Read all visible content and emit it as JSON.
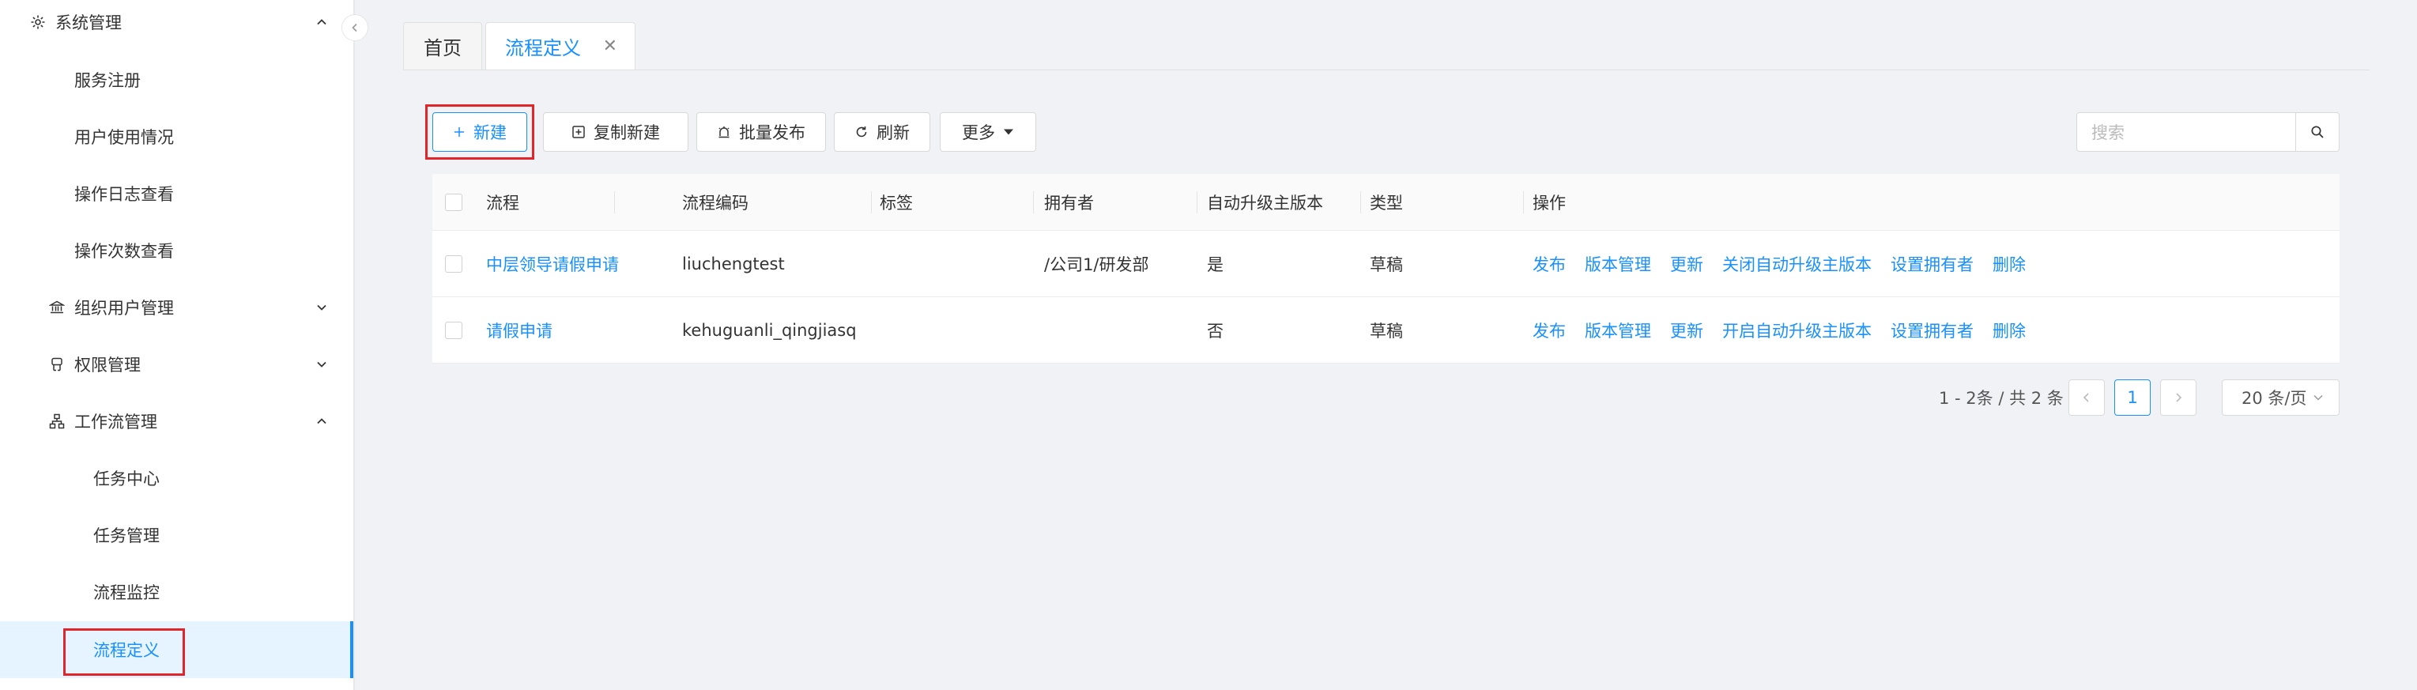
{
  "sidebar": {
    "items": [
      {
        "label": "系统管理",
        "icon": "gear-icon",
        "type": "group",
        "expanded": true
      },
      {
        "label": "服务注册",
        "type": "sub"
      },
      {
        "label": "用户使用情况",
        "type": "sub"
      },
      {
        "label": "操作日志查看",
        "type": "sub"
      },
      {
        "label": "操作次数查看",
        "type": "sub"
      },
      {
        "label": "组织用户管理",
        "icon": "bank-icon",
        "type": "group",
        "expanded": false
      },
      {
        "label": "权限管理",
        "icon": "user-key-icon",
        "type": "group",
        "expanded": false
      },
      {
        "label": "工作流管理",
        "icon": "workflow-icon",
        "type": "group",
        "expanded": true
      },
      {
        "label": "任务中心",
        "type": "sub2"
      },
      {
        "label": "任务管理",
        "type": "sub2"
      },
      {
        "label": "流程监控",
        "type": "sub2"
      },
      {
        "label": "流程定义",
        "type": "sub2",
        "active": true
      }
    ]
  },
  "tabs": {
    "home": "首页",
    "current": "流程定义",
    "close": "✕"
  },
  "toolbar": {
    "new_label": "新建",
    "copy_new_label": "复制新建",
    "batch_publish_label": "批量发布",
    "refresh_label": "刷新",
    "more_label": "更多",
    "search_placeholder": "搜索"
  },
  "table": {
    "columns": [
      "流程",
      "流程编码",
      "标签",
      "拥有者",
      "自动升级主版本",
      "类型",
      "操作"
    ],
    "rows": [
      {
        "name": "中层领导请假申请",
        "code": "liuchengtest",
        "tag": "",
        "owner": "/公司1/研发部",
        "auto_upgrade": "是",
        "type": "草稿",
        "ops": [
          "发布",
          "版本管理",
          "更新",
          "关闭自动升级主版本",
          "设置拥有者",
          "删除"
        ]
      },
      {
        "name": "请假申请",
        "code": "kehuguanli_qingjiasq",
        "tag": "",
        "owner": "",
        "auto_upgrade": "否",
        "type": "草稿",
        "ops": [
          "发布",
          "版本管理",
          "更新",
          "开启自动升级主版本",
          "设置拥有者",
          "删除"
        ]
      }
    ]
  },
  "pagination": {
    "total_text": "1 - 2条 / 共 2 条",
    "current_page": "1",
    "page_size": "20 条/页"
  },
  "colors": {
    "accent": "#1890ff",
    "highlight_box": "#e0262a"
  }
}
